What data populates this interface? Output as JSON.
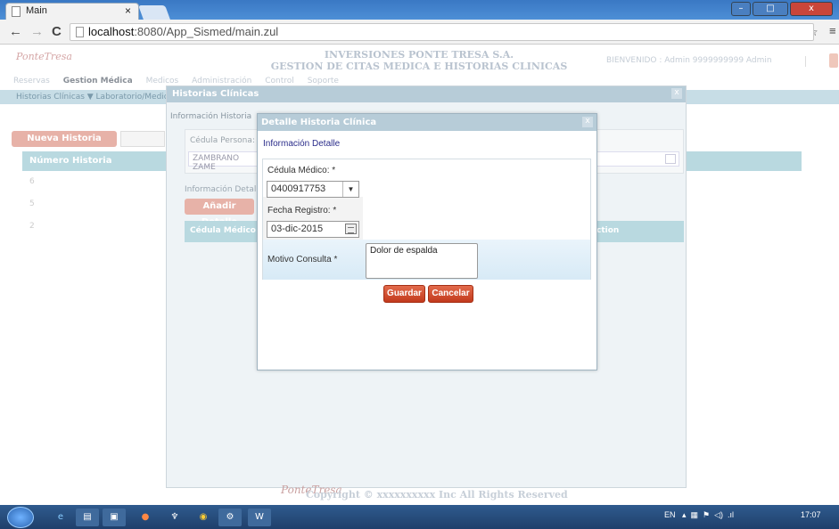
{
  "browser": {
    "tab_title": "Main",
    "tab_close": "×",
    "url_host": "localhost",
    "url_path": ":8080/App_Sismed/main.zul",
    "nav_back": "←",
    "nav_forward": "→",
    "nav_reload": "C",
    "window_minimize": "–",
    "window_maximize": "□",
    "window_close": "x"
  },
  "app": {
    "logo_text": "PonteTresa",
    "title_line1": "INVERSIONES PONTE TRESA S.A.",
    "title_line2": "GESTION DE CITAS MEDICA E HISTORIAS CLINICAS",
    "welcome": "BIENVENIDO : Admin 9999999999 Admin",
    "menu": [
      "Reservas",
      "Gestion Médica",
      "Medicos",
      "Administración",
      "Control",
      "Soporte"
    ],
    "submenu": "Historias Clínicas ▼  Laboratorio/Medicina ▼  Enfermedades",
    "new_history_button": "Nueva Historia Clínica",
    "grid_header": "Número Historia",
    "grid_rows": [
      "6",
      "5",
      "2"
    ],
    "footer": "Copyright © xxxxxxxxxx Inc All Rights Reserved",
    "footer_logo": "PonteTresa"
  },
  "historia_window": {
    "title": "Historias Clínicas",
    "close": "x",
    "section_info": "Información Historia",
    "cedula_label": "Cédula Persona: *",
    "cedula_value": "ZAMBRANO ZAME",
    "detail_label": "Información Detalle",
    "add_detail_button": "Añadir Detalle",
    "grid_col1": "Cédula Médico",
    "grid_col2": "ction"
  },
  "detalle_modal": {
    "title": "Detalle Historia Clínica",
    "close": "x",
    "section": "Información Detalle",
    "cedula_medico_label": "Cédula Médico: *",
    "cedula_medico_value": "0400917753",
    "fecha_label": "Fecha Registro: *",
    "fecha_value": "03-dic-2015",
    "motivo_label": "Motivo Consulta *",
    "motivo_value": "Dolor de espalda",
    "save_button": "Guardar",
    "cancel_button": "Cancelar"
  },
  "taskbar": {
    "tray_lang": "EN",
    "clock": "17:07"
  },
  "colors": {
    "accent_button": "#c23a1d",
    "header_blue": "#b7ccd8",
    "taskbar": "#1f3f6b"
  }
}
